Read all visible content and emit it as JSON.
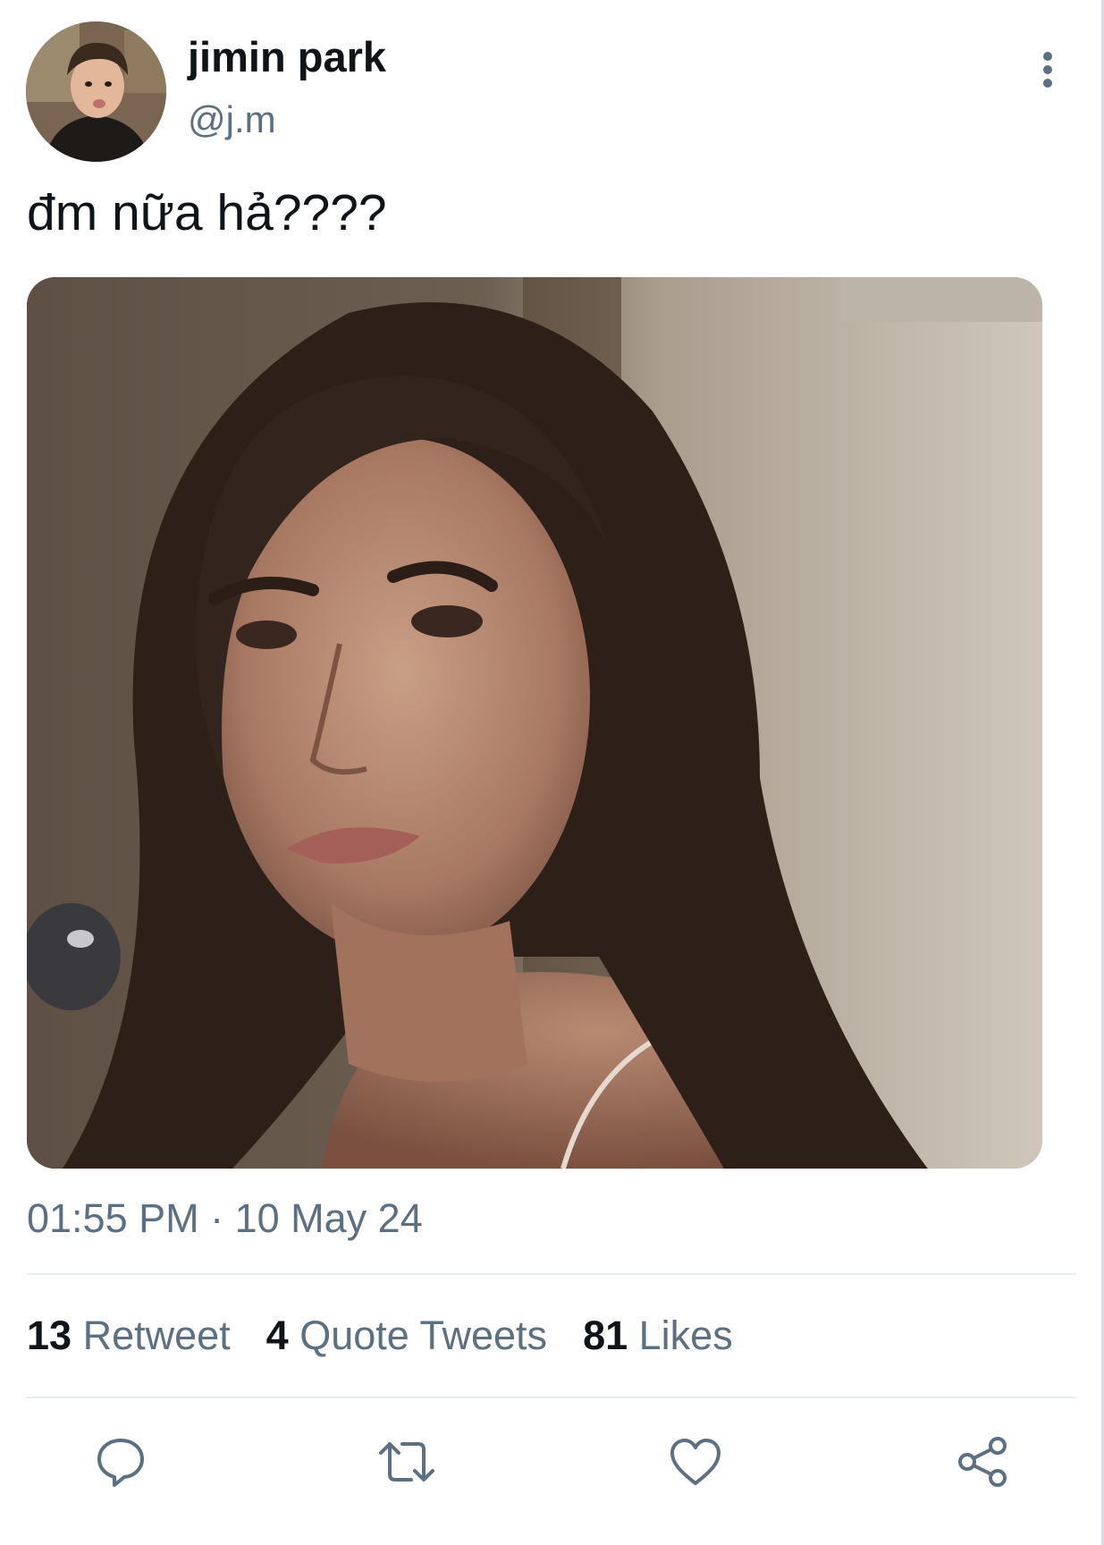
{
  "user": {
    "name": "jimin park",
    "handle": "@j.m"
  },
  "tweet": {
    "text": "đm nữa hả????",
    "timestamp": "01:55 PM · 10 May 24"
  },
  "stats": {
    "retweets_count": "13",
    "retweets_label": "Retweet",
    "quotes_count": "4",
    "quotes_label": "Quote Tweets",
    "likes_count": "81",
    "likes_label": "Likes"
  },
  "icons": {
    "more": "more-vertical-icon",
    "reply": "reply-icon",
    "retweet": "retweet-icon",
    "like": "heart-icon",
    "share": "share-icon"
  },
  "colors": {
    "text_primary": "#0f1419",
    "text_secondary": "#5b7083",
    "divider": "#e6ecf0",
    "icon": "#5b7083"
  }
}
